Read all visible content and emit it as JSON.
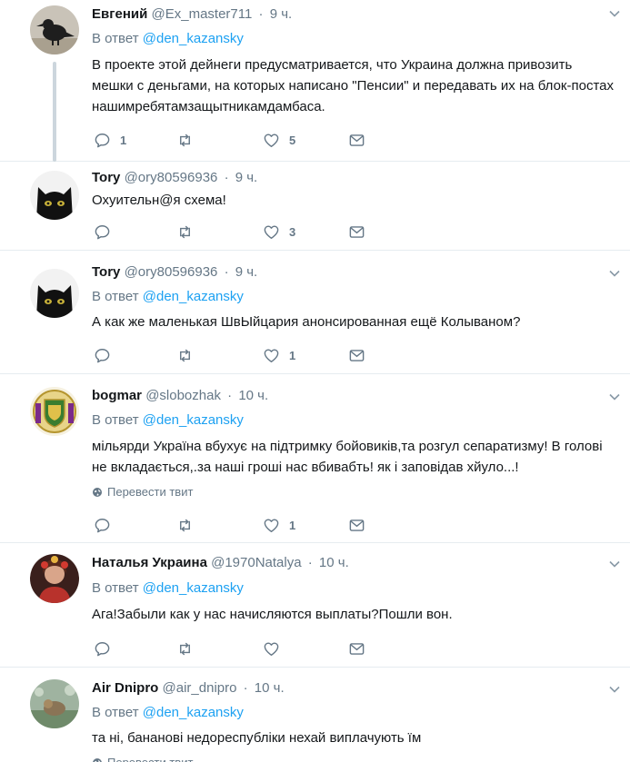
{
  "reply_prefix": "В ответ",
  "tweets": [
    {
      "name": "Евгений",
      "handle": "@Ex_master711",
      "time": "9 ч.",
      "reply_to": "@den_kazansky",
      "text": "В проекте этой дейнеги предусматривается, что Украина должна привозить мешки с деньгами, на которых написано \"Пенсии\" и передавать их на блок-постах нашимребятамзащытникамдамбаса.",
      "replies": "1",
      "retweets": "",
      "likes": "5"
    },
    {
      "name": "Tory",
      "handle": "@ory80596936",
      "time": "9 ч.",
      "reply_to": "",
      "text": "Охуительн@я схема!",
      "replies": "",
      "retweets": "",
      "likes": "3"
    },
    {
      "name": "Tory",
      "handle": "@ory80596936",
      "time": "9 ч.",
      "reply_to": "@den_kazansky",
      "text": "А как же маленькая ШвЫйцария анонсированная ещё Колываном?",
      "replies": "",
      "retweets": "",
      "likes": "1"
    },
    {
      "name": "bogmar",
      "handle": "@slobozhak",
      "time": "10 ч.",
      "reply_to": "@den_kazansky",
      "text": "мільярди Україна вбухує на підтримку бойовиків,та розгул сепаратизму! В голові не вкладається,.за наші гроші нас вбивабть! як і заповідав хйуло...!",
      "translate": "Перевести твит",
      "replies": "",
      "retweets": "",
      "likes": "1"
    },
    {
      "name": "Наталья Украина",
      "handle": "@1970Natalya",
      "time": "10 ч.",
      "reply_to": "@den_kazansky",
      "text": "Ага!Забыли как у нас начисляются выплаты?Пошли вон.",
      "replies": "",
      "retweets": "",
      "likes": ""
    },
    {
      "name": "Air Dnipro",
      "handle": "@air_dnipro",
      "time": "10 ч.",
      "reply_to": "@den_kazansky",
      "text": "та ні, бананові недореспубліки нехай виплачують їм",
      "translate": "Перевести твит"
    }
  ],
  "colors": {
    "link": "#1da1f2",
    "secondary_text": "#657786",
    "divider": "#e6ecf0",
    "thread_line": "#ccd6dd"
  }
}
